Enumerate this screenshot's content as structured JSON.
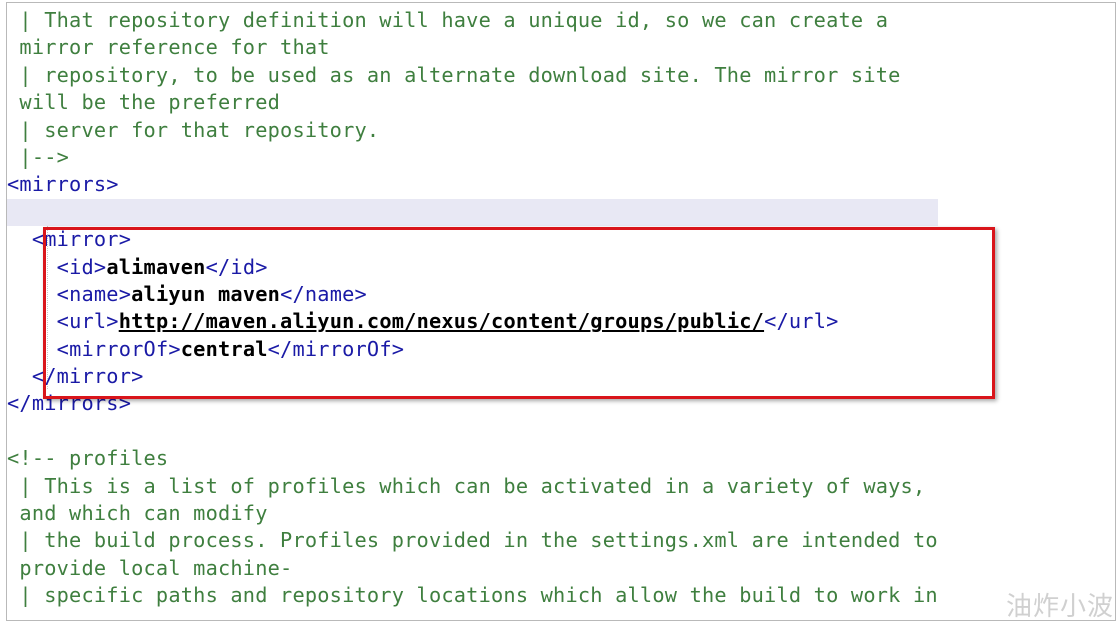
{
  "lines": [
    {
      "kind": "comment",
      "text": " | That repository definition will have a unique id, so we can create a"
    },
    {
      "kind": "comment",
      "text": " mirror reference for that"
    },
    {
      "kind": "comment",
      "text": " | repository, to be used as an alternate download site. The mirror site"
    },
    {
      "kind": "comment",
      "text": " will be the preferred"
    },
    {
      "kind": "comment",
      "text": " | server for that repository."
    },
    {
      "kind": "comment",
      "text": " |-->"
    },
    {
      "kind": "tag",
      "text": "<mirrors>"
    },
    {
      "kind": "blank",
      "text": ""
    },
    {
      "kind": "element",
      "indent": "  ",
      "open": "<mirror>",
      "value": "",
      "close": ""
    },
    {
      "kind": "element",
      "indent": "    ",
      "open": "<id>",
      "value": "alimaven",
      "close": "</id>"
    },
    {
      "kind": "element",
      "indent": "    ",
      "open": "<name>",
      "value": "aliyun maven",
      "close": "</name>"
    },
    {
      "kind": "element",
      "indent": "    ",
      "open": "<url>",
      "value": "http://maven.aliyun.com/nexus/content/groups/public/",
      "close": "</url>",
      "underline": true
    },
    {
      "kind": "element",
      "indent": "    ",
      "open": "<mirrorOf>",
      "value": "central",
      "close": "</mirrorOf>"
    },
    {
      "kind": "element",
      "indent": "  ",
      "open": "</mirror>",
      "value": "",
      "close": ""
    },
    {
      "kind": "tag",
      "text": "</mirrors>"
    },
    {
      "kind": "blank",
      "text": ""
    },
    {
      "kind": "comment",
      "text": "<!-- profiles"
    },
    {
      "kind": "comment",
      "text": " | This is a list of profiles which can be activated in a variety of ways,"
    },
    {
      "kind": "comment",
      "text": " and which can modify"
    },
    {
      "kind": "comment",
      "text": " | the build process. Profiles provided in the settings.xml are intended to"
    },
    {
      "kind": "comment",
      "text": " provide local machine-"
    },
    {
      "kind": "comment",
      "text": " | specific paths and repository locations which allow the build to work in"
    }
  ],
  "highlighted_line": 7,
  "watermark": "油炸小波",
  "colors": {
    "comment": "#3f7f3f",
    "tag": "#1a1aa6",
    "value": "#000000",
    "current_line": "#e8e8f4",
    "selection_box": "#d9151b"
  }
}
